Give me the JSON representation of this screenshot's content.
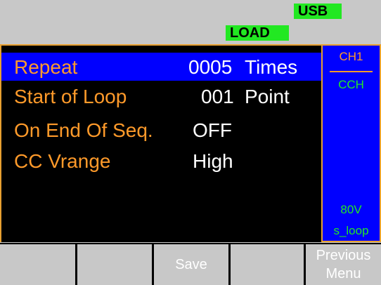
{
  "status": {
    "usb": "USB",
    "load": "LOAD"
  },
  "rows": [
    {
      "label": "Repeat",
      "value": "0005",
      "unit": "Times"
    },
    {
      "label": "Start of Loop",
      "value": "001",
      "unit": "Point"
    },
    {
      "label": "On End Of Seq.",
      "value": "OFF",
      "unit": ""
    },
    {
      "label": "CC Vrange",
      "value": "High",
      "unit": ""
    }
  ],
  "side": {
    "channel": "CH1",
    "mode": "CCH",
    "voltage": "80V",
    "file": "s_loop"
  },
  "softkeys": [
    "",
    "",
    "Save",
    "",
    "Previous Menu"
  ],
  "colors": {
    "label": "#ff9a2a",
    "status_green": "#22e822",
    "selection": "#0000ff"
  }
}
